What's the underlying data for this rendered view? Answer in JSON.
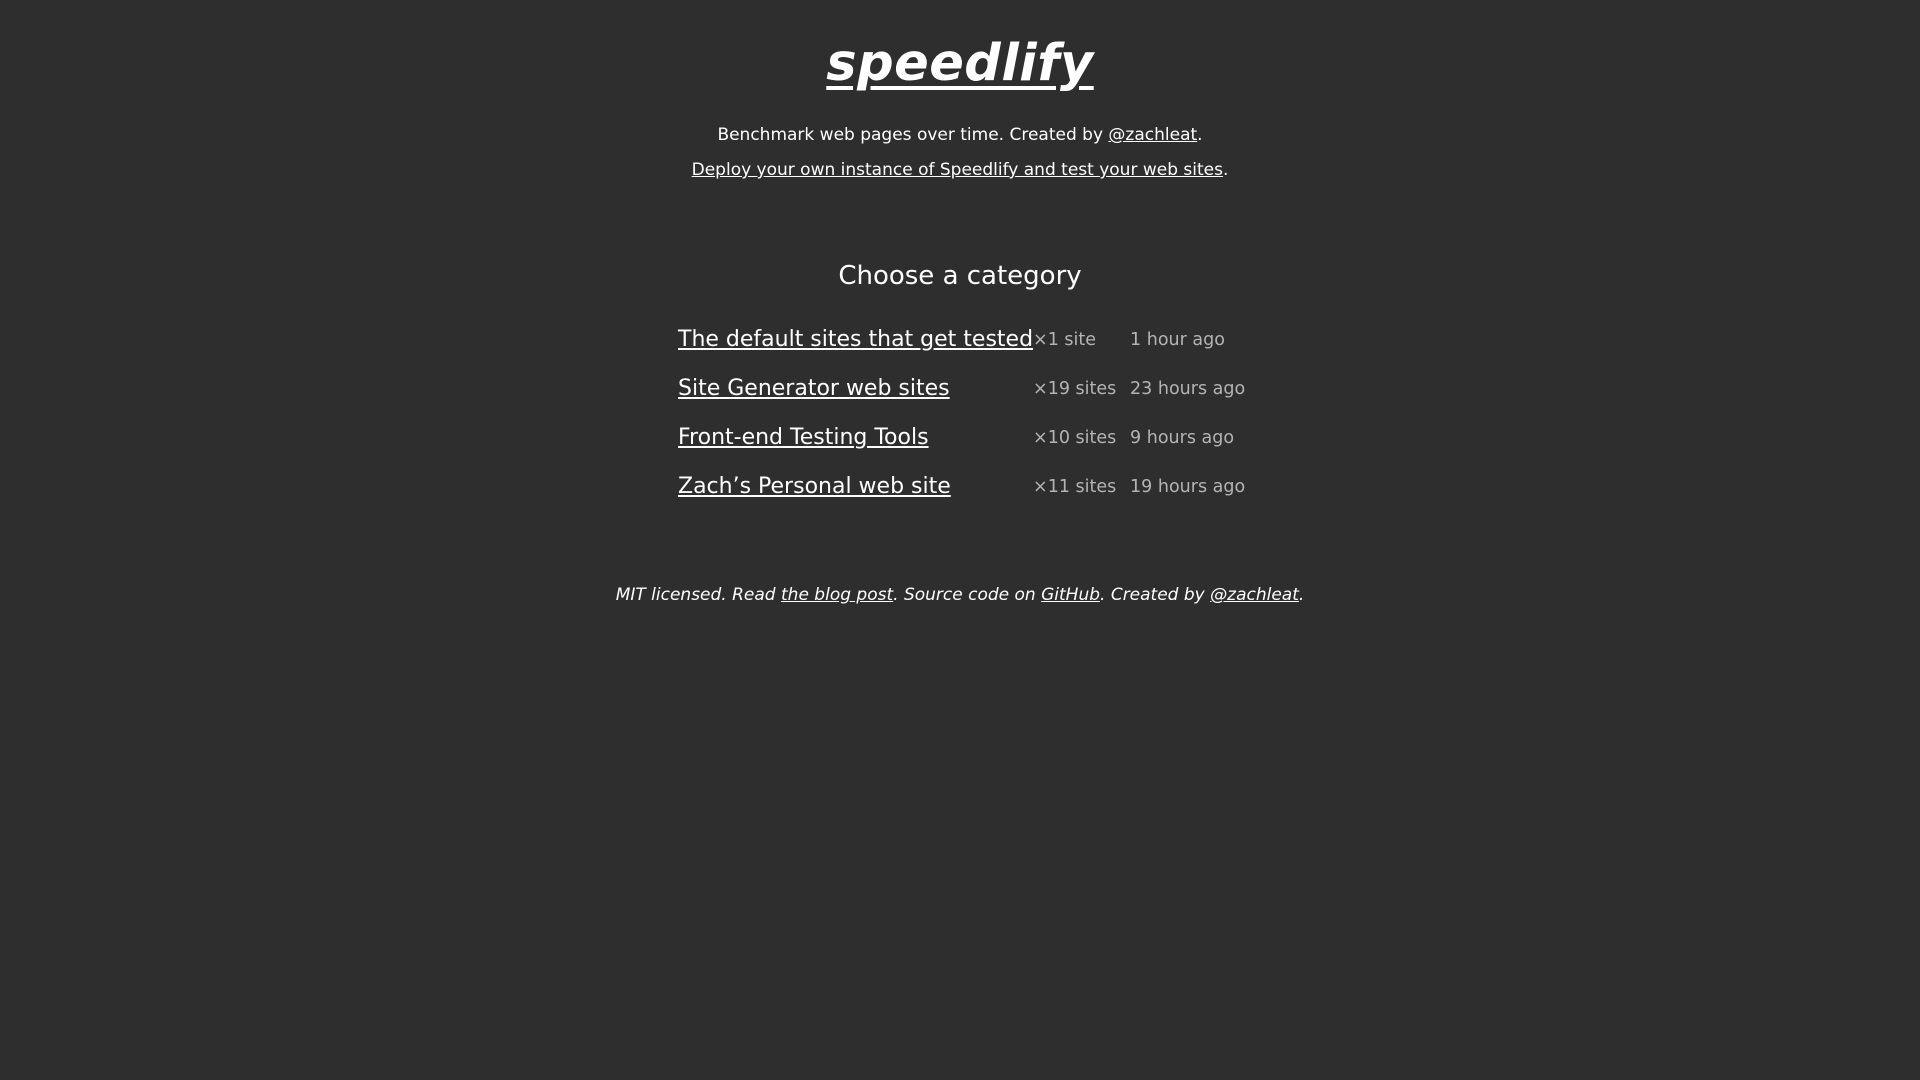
{
  "header": {
    "logo": "speedlify",
    "tagline_prefix": "Benchmark web pages over time. Created by ",
    "tagline_link": "@zachleat",
    "tagline_suffix": ".",
    "deploy_link": "Deploy your own instance of Speedlify and test your web sites",
    "deploy_suffix": "."
  },
  "main": {
    "heading": "Choose a category",
    "categories": [
      {
        "name": "The default sites that get tested",
        "count": "×1 site",
        "updated": "1 hour ago"
      },
      {
        "name": "Site Generator web sites",
        "count": "×19 sites",
        "updated": "23 hours ago"
      },
      {
        "name": "Front-end Testing Tools",
        "count": "×10 sites",
        "updated": "9 hours ago"
      },
      {
        "name": "Zach’s Personal web site",
        "count": "×11 sites",
        "updated": "19 hours ago"
      }
    ]
  },
  "footer": {
    "text1": "MIT licensed. Read ",
    "blog_link": "the blog post",
    "text2": ". Source code on ",
    "github_link": "GitHub",
    "text3": ". Created by ",
    "author_link": "@zachleat",
    "text4": "."
  }
}
